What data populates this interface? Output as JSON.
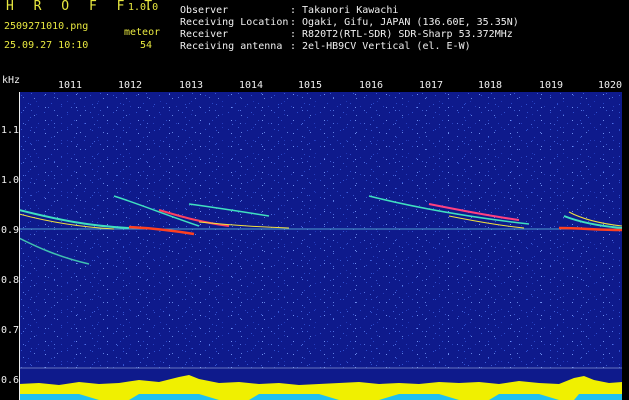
{
  "header": {
    "app_title": "H R O F F T",
    "version": "1.0.0",
    "file_name": "2509271010.png",
    "meteor_label": "meteor",
    "datetime": "25.09.27 10:10",
    "meteor_count": "54",
    "info": [
      {
        "label": "Observer",
        "value": ": Takanori Kawachi"
      },
      {
        "label": "Receiving Location",
        "value": ": Ogaki, Gifu, JAPAN (136.60E, 35.35N)"
      },
      {
        "label": "Receiver",
        "value": ": R820T2(RTL-SDR) SDR-Sharp 53.372MHz"
      },
      {
        "label": "Receiving antenna",
        "value": ": 2el-HB9CV Vertical (el. E-W)"
      }
    ]
  },
  "axes": {
    "y_unit": "kHz",
    "y_ticks": [
      "1.1",
      "1.0",
      "0.9",
      "0.8",
      "0.7",
      "0.6"
    ],
    "x_ticks": [
      "1011",
      "1012",
      "1013",
      "1014",
      "1015",
      "1016",
      "1017",
      "1018",
      "1019",
      "1020"
    ]
  },
  "colors": {
    "background": "#0e1a8c",
    "header_text": "#e8e840",
    "info_text": "#f0f0f0",
    "level_fill": "#f0f000",
    "level_cyan": "#20c0f0",
    "trail_hot": "#ff4020",
    "trail_warm": "#f0e040",
    "trail_cool": "#40e0c0"
  }
}
